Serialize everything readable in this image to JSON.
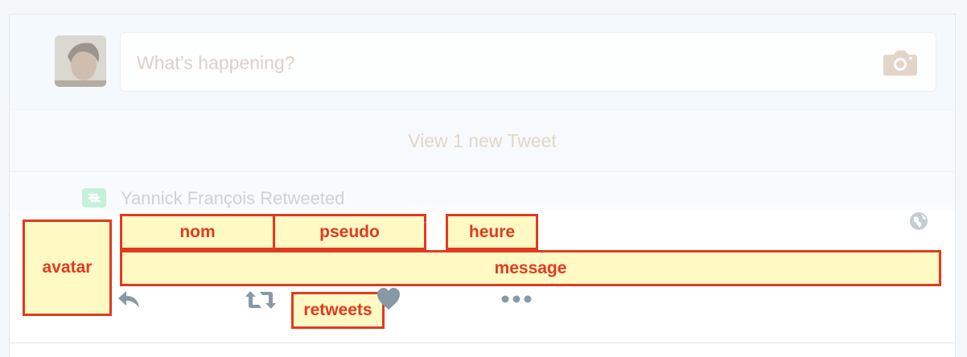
{
  "compose": {
    "placeholder": "What’s happening?"
  },
  "new_tweets": {
    "label": "View 1 new Tweet"
  },
  "tweet": {
    "retweet_context": "Yannick François Retweeted",
    "avatar": "avatar",
    "name": "nom",
    "handle": "pseudo",
    "separator": "·",
    "time": "heure",
    "message": "message",
    "retweets": "retweets"
  },
  "colors": {
    "annotation_border": "#e23a1f",
    "annotation_fill": "#fff9c4",
    "retweet_green": "#17bf63",
    "action_gray": "#8899a6"
  },
  "icons": [
    "camera-icon",
    "retweet-icon",
    "globe-icon",
    "reply-icon",
    "like-icon",
    "more-icon"
  ]
}
